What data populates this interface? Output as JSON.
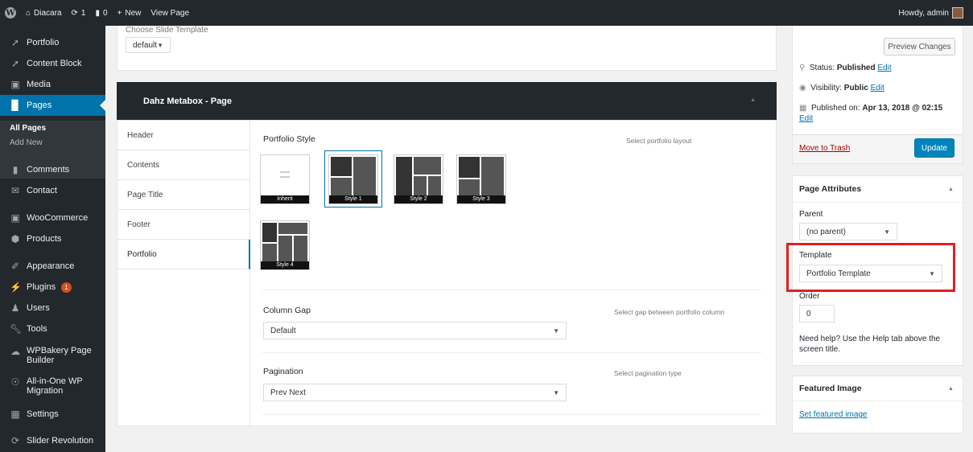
{
  "adminbar": {
    "site_name": "Diacara",
    "updates_count": "1",
    "comments_count": "0",
    "new_label": "New",
    "view_page": "View Page",
    "howdy": "Howdy, admin"
  },
  "sidebar": {
    "items": [
      {
        "label": "Portfolio",
        "icon": "pin-icon"
      },
      {
        "label": "Content Block",
        "icon": "pin-icon"
      },
      {
        "label": "Media",
        "icon": "media-icon"
      },
      {
        "label": "Pages",
        "icon": "pages-icon"
      },
      {
        "label": "Comments",
        "icon": "comments-icon"
      },
      {
        "label": "Contact",
        "icon": "mail-icon"
      },
      {
        "label": "WooCommerce",
        "icon": "woo-icon"
      },
      {
        "label": "Products",
        "icon": "products-icon"
      },
      {
        "label": "Appearance",
        "icon": "appearance-icon"
      },
      {
        "label": "Plugins",
        "icon": "plugins-icon"
      },
      {
        "label": "Users",
        "icon": "users-icon"
      },
      {
        "label": "Tools",
        "icon": "tools-icon"
      },
      {
        "label": "WPBakery Page Builder",
        "icon": "wpbakery-icon"
      },
      {
        "label": "All-in-One WP Migration",
        "icon": "migration-icon"
      },
      {
        "label": "Settings",
        "icon": "settings-icon"
      },
      {
        "label": "Slider Revolution",
        "icon": "slider-icon"
      }
    ],
    "plugins_badge": "1",
    "submenu": {
      "all_pages": "All Pages",
      "add_new": "Add New"
    }
  },
  "slide_template": {
    "label": "Choose Slide Template",
    "value": "default"
  },
  "metabox": {
    "title": "Dahz Metabox - Page",
    "tabs": [
      "Header",
      "Contents",
      "Page Title",
      "Footer",
      "Portfolio"
    ],
    "active_tab": "Portfolio",
    "portfolio_style": {
      "label": "Portfolio Style",
      "description": "Select portfolio layout",
      "options": [
        "Inherit",
        "Style 1",
        "Style 2",
        "Style 3",
        "Style 4"
      ],
      "selected": "Style 1"
    },
    "column_gap": {
      "label": "Column Gap",
      "description": "Select gap between portfolio column",
      "value": "Default"
    },
    "pagination": {
      "label": "Pagination",
      "description": "Select pagination type",
      "value": "Prev Next"
    }
  },
  "publish": {
    "preview_button": "Preview Changes",
    "status_label": "Status:",
    "status_value": "Published",
    "visibility_label": "Visibility:",
    "visibility_value": "Public",
    "published_label": "Published on:",
    "published_value": "Apr 13, 2018 @ 02:15",
    "edit": "Edit",
    "trash": "Move to Trash",
    "update_button": "Update"
  },
  "page_attributes": {
    "title": "Page Attributes",
    "parent_label": "Parent",
    "parent_value": "(no parent)",
    "template_label": "Template",
    "template_value": "Portfolio Template",
    "order_label": "Order",
    "order_value": "0",
    "help_text": "Need help? Use the Help tab above the screen title."
  },
  "featured_image": {
    "title": "Featured Image",
    "link": "Set featured image"
  },
  "colors": {
    "accent": "#0073aa",
    "highlight_border": "#e0201f",
    "admin_dark": "#23282d"
  }
}
